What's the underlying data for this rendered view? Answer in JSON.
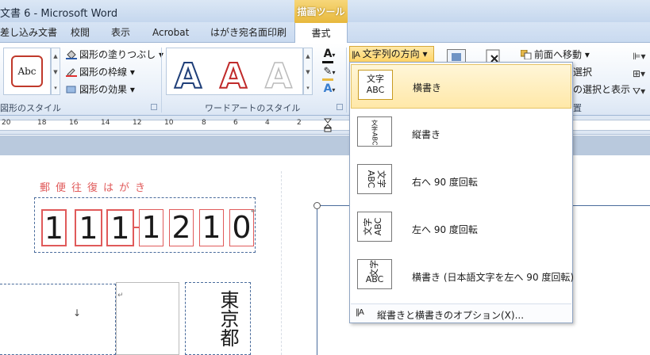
{
  "window": {
    "title": "文書 6 - Microsoft Word",
    "context_tab_group": "描画ツール"
  },
  "tabs": [
    {
      "label": "差し込み文書"
    },
    {
      "label": "校閲"
    },
    {
      "label": "表示"
    },
    {
      "label": "Acrobat"
    },
    {
      "label": "はがき宛名面印刷"
    },
    {
      "label": "書式"
    }
  ],
  "ribbon": {
    "shape_styles": {
      "group_label": "図形のスタイル",
      "sample": "Abc",
      "fill": "図形の塗りつぶし",
      "outline": "図形の枠線",
      "effects": "図形の効果"
    },
    "wordart_styles": {
      "group_label": "ワードアートのスタイル",
      "sample": "A"
    },
    "text": {
      "direction_button": "文字列の方向"
    },
    "arrange": {
      "bring_forward": "前面へ移動",
      "selection_partial": "の選択と表示",
      "select_partial": "選択",
      "group_partial": "置"
    }
  },
  "ruler": {
    "ticks": [
      "20",
      "18",
      "16",
      "14",
      "12",
      "10",
      "8",
      "6",
      "4",
      "2"
    ]
  },
  "document": {
    "postcard_title": "郵便往復はがき",
    "postal_code": [
      "1",
      "1",
      "1",
      "1",
      "2",
      "1",
      "0"
    ],
    "address_vertical": "東京都",
    "down_arrow": "↓"
  },
  "text_direction_menu": {
    "items": [
      {
        "label": "横書き",
        "icon_text": "文字\nABC",
        "selected": true
      },
      {
        "label": "縦書き",
        "icon_text": "縦書き"
      },
      {
        "label": "右へ 90 度回転",
        "icon_text": "文字ABC"
      },
      {
        "label": "左へ 90 度回転",
        "icon_text": "文字ABC"
      },
      {
        "label": "横書き (日本語文字を左へ 90 度回転)",
        "icon_text": "文字\nABC"
      }
    ],
    "options": "縦書きと横書きのオプション(X)..."
  },
  "colors": {
    "accent_red": "#e05a5a",
    "context_gold": "#e8b93e",
    "ribbon_blue": "#c9daf0"
  }
}
